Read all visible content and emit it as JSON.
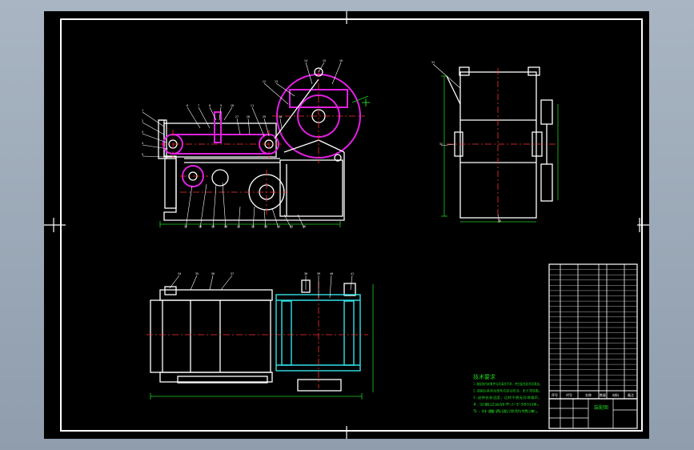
{
  "viewport": {
    "background": "#a5b1bf",
    "sheet": "#000000"
  },
  "colors": {
    "frame": "#ffffff",
    "outline": "#ffffff",
    "belt": "#e020e0",
    "centerline": "#ff3030",
    "dimension": "#20d020",
    "section": "#30e0e8",
    "leader": "#ffffff"
  },
  "front_view": {
    "balloons": [
      "1",
      "2",
      "3",
      "4",
      "5",
      "6",
      "7",
      "8",
      "9",
      "10",
      "11",
      "12",
      "13",
      "14",
      "15",
      "16",
      "17",
      "18",
      "19",
      "20",
      "21",
      "22",
      "23",
      "24",
      "25",
      "26",
      "27",
      "28",
      "29",
      "30"
    ]
  },
  "side_view": {
    "balloons": [
      "31",
      "32",
      "33"
    ]
  },
  "top_view": {
    "balloons": [
      "34",
      "35",
      "36",
      "37",
      "38",
      "39",
      "40",
      "41"
    ]
  },
  "notes": {
    "heading": "技术要求",
    "lines": [
      "1.装配前所有零件均须清洗干净，并在配合面涂润滑油。",
      "2.装配后各转动部件应转动灵活，无卡滞现象。",
      "3.皮带张紧适度，运转平稳无异常噪声。",
      "4.空载试运转不少于30分钟。",
      "5.外露表面涂防锈漆。"
    ]
  },
  "parts_list": {
    "rows": 24,
    "header": [
      "序号",
      "代号",
      "名称",
      "数量",
      "材料",
      "备注"
    ]
  },
  "title_block": {
    "drawing_title": "装配图"
  },
  "icons": [
    "crosshair-marker-icon"
  ]
}
